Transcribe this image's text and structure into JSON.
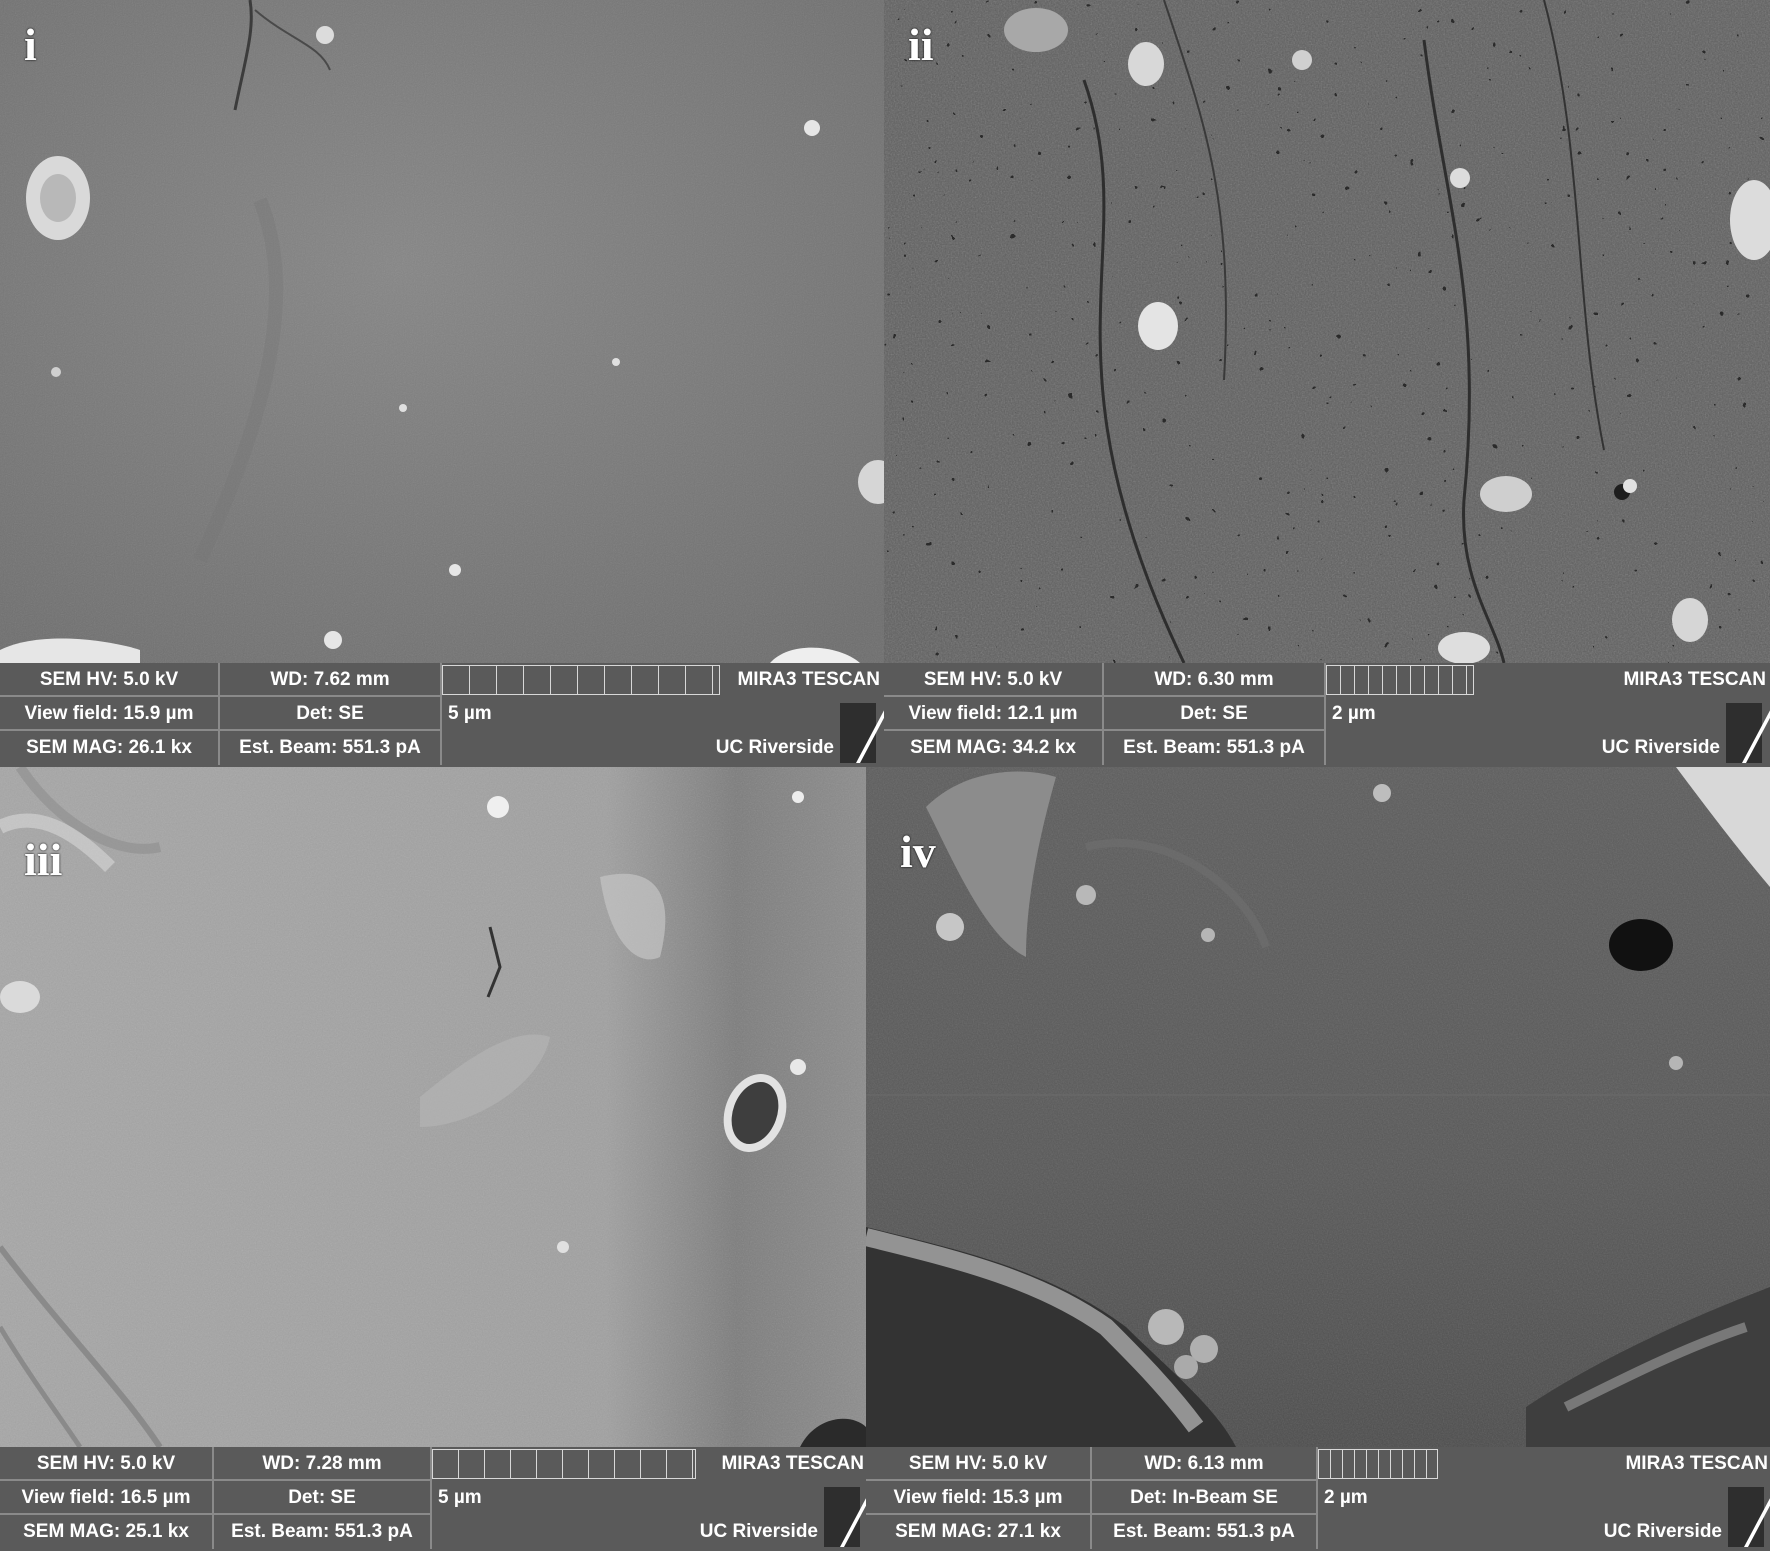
{
  "panels": [
    {
      "label": "i",
      "hv": "SEM HV: 5.0 kV",
      "view_field": "View field: 15.9 µm",
      "mag": "SEM MAG: 26.1 kx",
      "wd": "WD: 7.62 mm",
      "det": "Det: SE",
      "beam": "Est. Beam: 551.3 pA",
      "scale": "5 µm",
      "brand": "MIRA3 TESCAN",
      "lab": "UC Riverside",
      "tone": "#7a7a7a"
    },
    {
      "label": "ii",
      "hv": "SEM HV: 5.0 kV",
      "view_field": "View field: 12.1 µm",
      "mag": "SEM MAG: 34.2 kx",
      "wd": "WD: 6.30 mm",
      "det": "Det: SE",
      "beam": "Est. Beam: 551.3 pA",
      "scale": "2 µm",
      "brand": "MIRA3 TESCAN",
      "lab": "UC Riverside",
      "tone": "#5e5e5e"
    },
    {
      "label": "iii",
      "hv": "SEM HV: 5.0 kV",
      "view_field": "View field: 16.5 µm",
      "mag": "SEM MAG: 25.1 kx",
      "wd": "WD: 7.28 mm",
      "det": "Det: SE",
      "beam": "Est. Beam: 551.3 pA",
      "scale": "5 µm",
      "brand": "MIRA3 TESCAN",
      "lab": "UC Riverside",
      "tone": "#a2a2a2"
    },
    {
      "label": "iv",
      "hv": "SEM HV: 5.0 kV",
      "view_field": "View field: 15.3 µm",
      "mag": "SEM MAG: 27.1 kx",
      "wd": "WD: 6.13 mm",
      "det": "Det: In-Beam SE",
      "beam": "Est. Beam: 551.3 pA",
      "scale": "2 µm",
      "brand": "MIRA3 TESCAN",
      "lab": "UC Riverside",
      "tone": "#5a5a5a"
    }
  ]
}
